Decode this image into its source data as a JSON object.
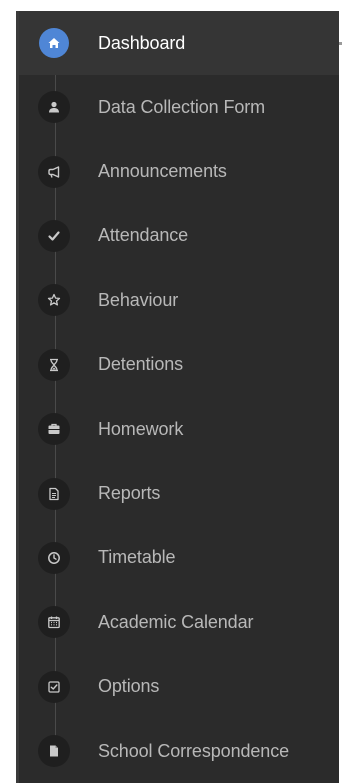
{
  "sidebar": {
    "items": [
      {
        "label": "Dashboard",
        "icon": "home-icon",
        "active": true
      },
      {
        "label": "Data Collection Form",
        "icon": "user-icon"
      },
      {
        "label": "Announcements",
        "icon": "megaphone-icon"
      },
      {
        "label": "Attendance",
        "icon": "check-icon"
      },
      {
        "label": "Behaviour",
        "icon": "star-icon"
      },
      {
        "label": "Detentions",
        "icon": "hourglass-icon"
      },
      {
        "label": "Homework",
        "icon": "briefcase-icon"
      },
      {
        "label": "Reports",
        "icon": "document-icon"
      },
      {
        "label": "Timetable",
        "icon": "clock-icon"
      },
      {
        "label": "Academic Calendar",
        "icon": "calendar-icon"
      },
      {
        "label": "Options",
        "icon": "checkbox-icon"
      },
      {
        "label": "School Correspondence",
        "icon": "file-icon"
      }
    ]
  },
  "colors": {
    "panel_background": "#2b2b2b",
    "active_background": "#353535",
    "active_icon": "#4f86d6",
    "label_text": "#b8b8b8",
    "active_label_text": "#ffffff"
  }
}
